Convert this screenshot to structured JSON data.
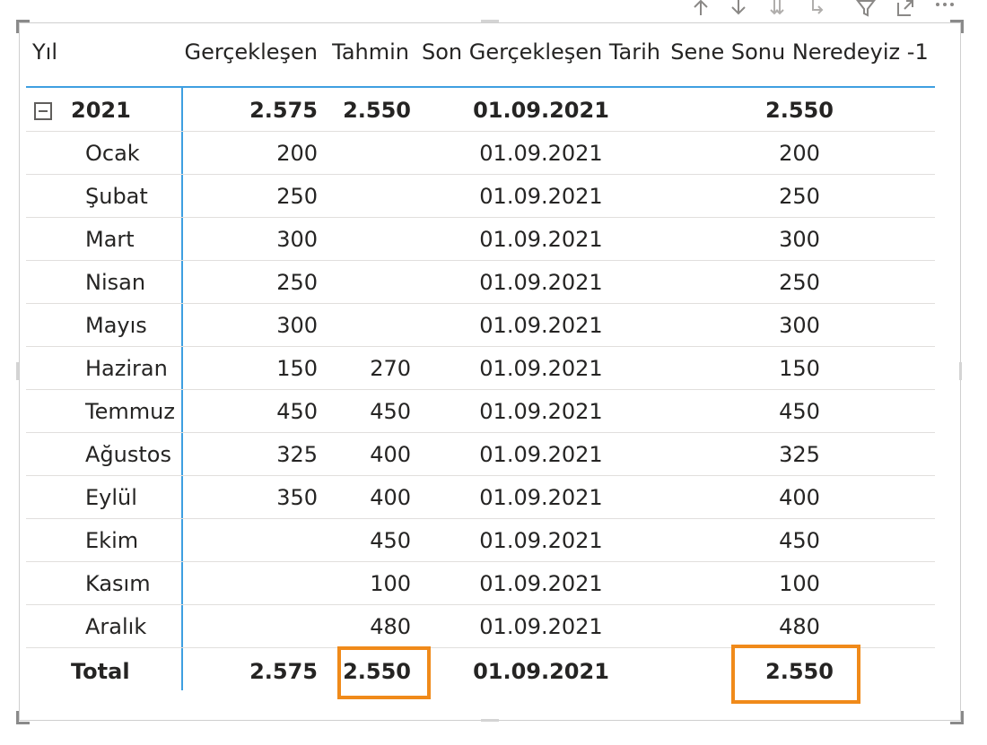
{
  "headers": {
    "yil": "Yıl",
    "gerceklesen": "Gerçekleşen",
    "tahmin": "Tahmin",
    "son_tarih": "Son Gerçekleşen Tarih",
    "sene_sonu": "Sene Sonu Neredeyiz -1"
  },
  "year_row": {
    "label": "2021",
    "gerceklesen": "2.575",
    "tahmin": "2.550",
    "son_tarih": "01.09.2021",
    "sene_sonu": "2.550"
  },
  "months": [
    {
      "label": "Ocak",
      "gerceklesen": "200",
      "tahmin": "",
      "son_tarih": "01.09.2021",
      "sene_sonu": "200"
    },
    {
      "label": "Şubat",
      "gerceklesen": "250",
      "tahmin": "",
      "son_tarih": "01.09.2021",
      "sene_sonu": "250"
    },
    {
      "label": "Mart",
      "gerceklesen": "300",
      "tahmin": "",
      "son_tarih": "01.09.2021",
      "sene_sonu": "300"
    },
    {
      "label": "Nisan",
      "gerceklesen": "250",
      "tahmin": "",
      "son_tarih": "01.09.2021",
      "sene_sonu": "250"
    },
    {
      "label": "Mayıs",
      "gerceklesen": "300",
      "tahmin": "",
      "son_tarih": "01.09.2021",
      "sene_sonu": "300"
    },
    {
      "label": "Haziran",
      "gerceklesen": "150",
      "tahmin": "270",
      "son_tarih": "01.09.2021",
      "sene_sonu": "150"
    },
    {
      "label": "Temmuz",
      "gerceklesen": "450",
      "tahmin": "450",
      "son_tarih": "01.09.2021",
      "sene_sonu": "450"
    },
    {
      "label": "Ağustos",
      "gerceklesen": "325",
      "tahmin": "400",
      "son_tarih": "01.09.2021",
      "sene_sonu": "325"
    },
    {
      "label": "Eylül",
      "gerceklesen": "350",
      "tahmin": "400",
      "son_tarih": "01.09.2021",
      "sene_sonu": "400"
    },
    {
      "label": "Ekim",
      "gerceklesen": "",
      "tahmin": "450",
      "son_tarih": "01.09.2021",
      "sene_sonu": "450"
    },
    {
      "label": "Kasım",
      "gerceklesen": "",
      "tahmin": "100",
      "son_tarih": "01.09.2021",
      "sene_sonu": "100"
    },
    {
      "label": "Aralık",
      "gerceklesen": "",
      "tahmin": "480",
      "son_tarih": "01.09.2021",
      "sene_sonu": "480"
    }
  ],
  "total_row": {
    "label": "Total",
    "gerceklesen": "2.575",
    "tahmin": "2.550",
    "son_tarih": "01.09.2021",
    "sene_sonu": "2.550"
  },
  "colors": {
    "accent_blue": "#3e9fe1",
    "highlight_orange": "#f08a1a",
    "text": "#252423",
    "grid": "#e1dfdd"
  },
  "toolbar_icons": [
    "arrow-up-icon",
    "arrow-down-icon",
    "double-arrow-down-icon",
    "expand-down-icon",
    "filter-icon",
    "focus-mode-icon",
    "more-options-icon"
  ]
}
